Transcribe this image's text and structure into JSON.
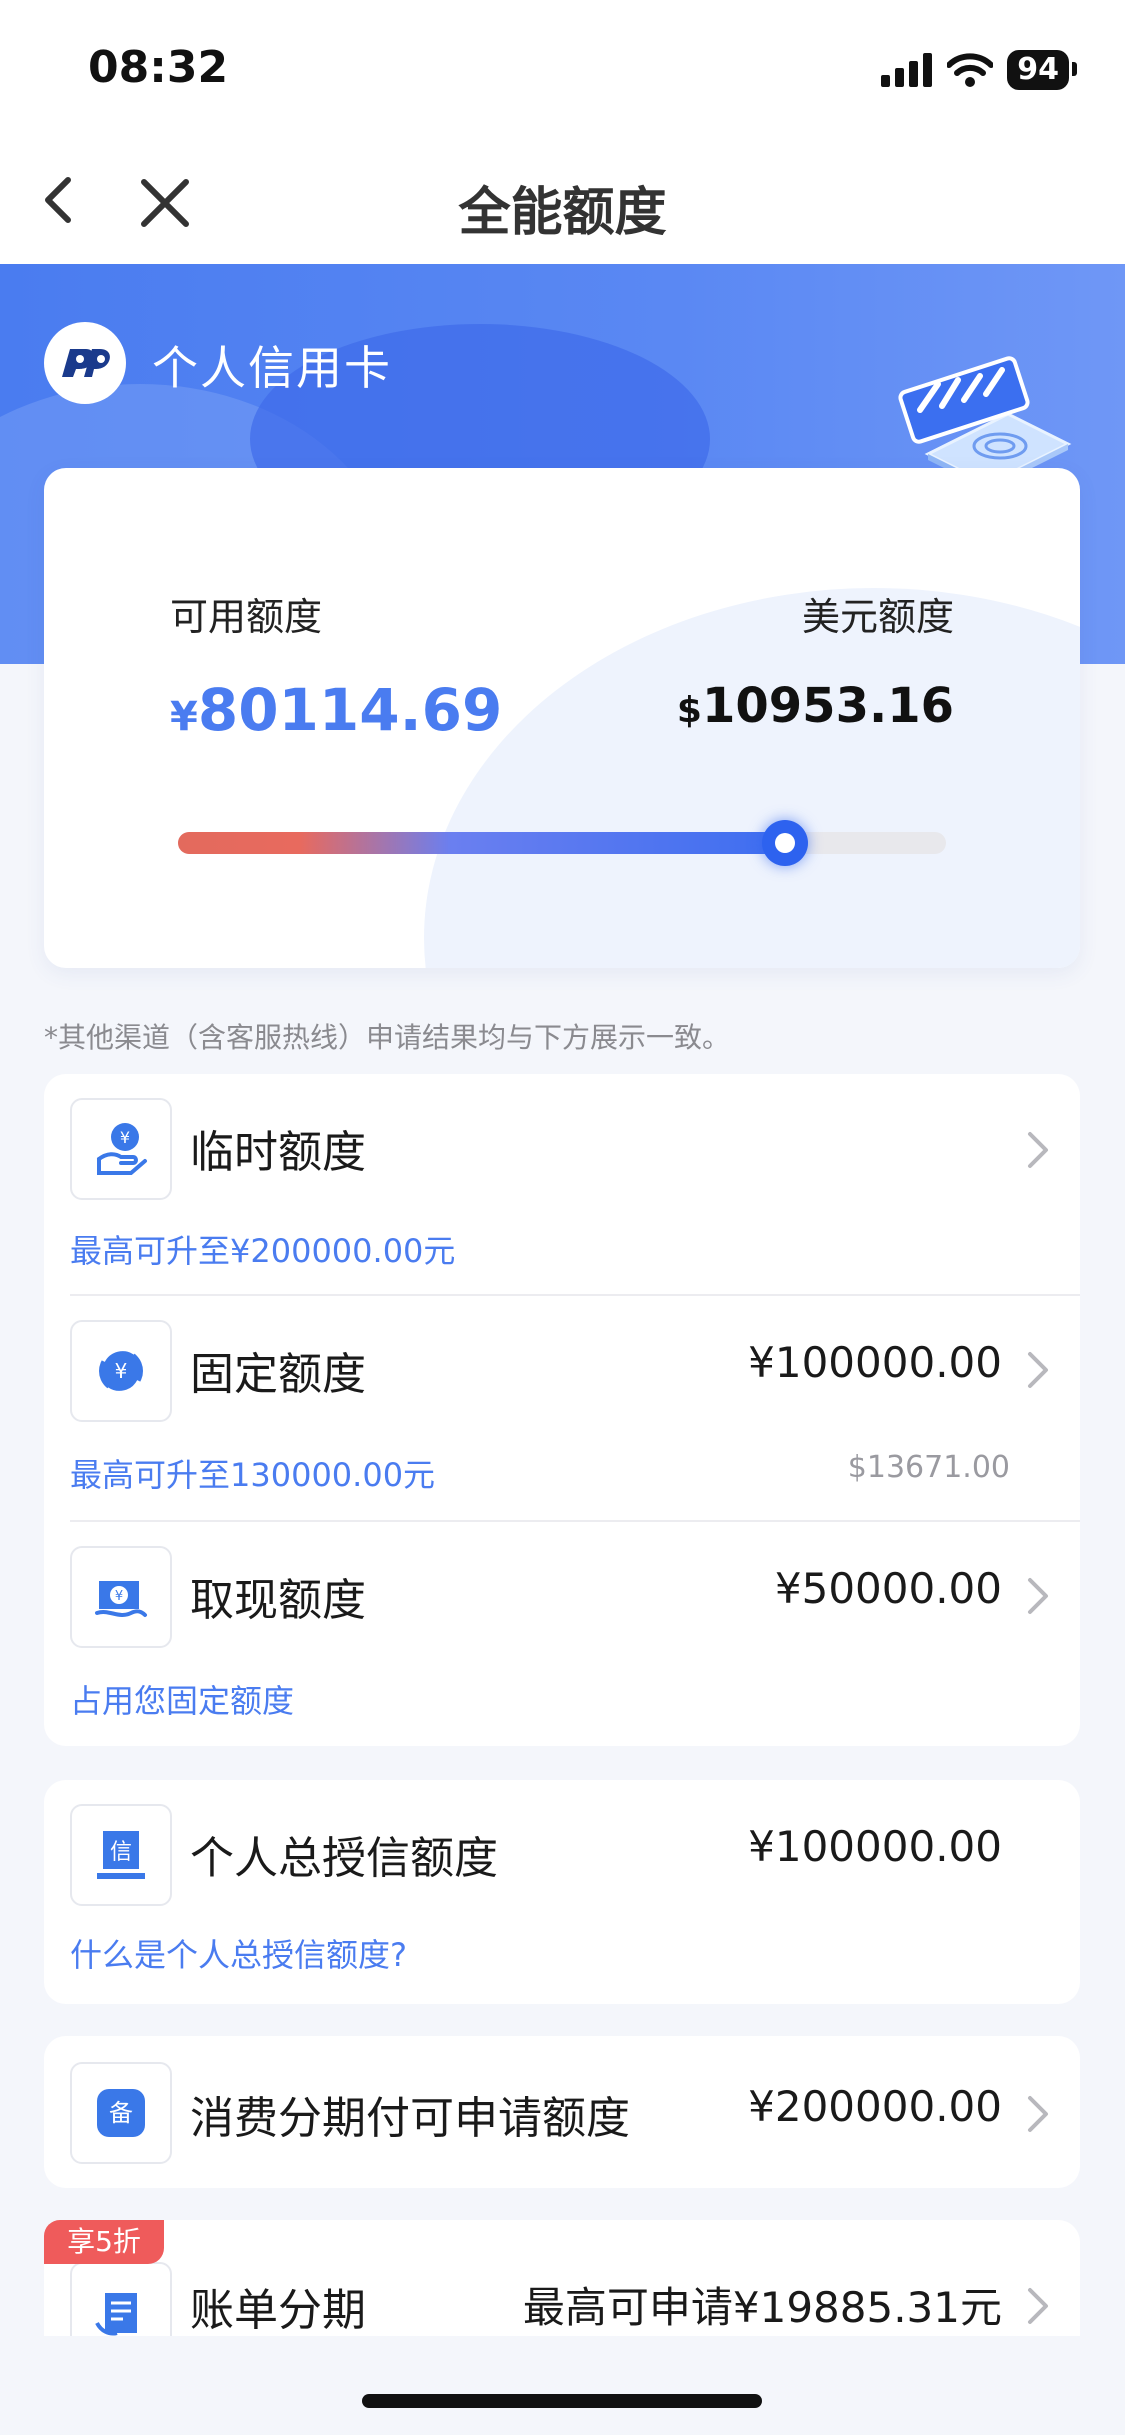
{
  "status_bar": {
    "time": "08:32",
    "battery": "94"
  },
  "nav": {
    "title": "全能额度"
  },
  "brand": {
    "name": "个人信用卡"
  },
  "limits": {
    "available_label": "可用额度",
    "available_currency": "¥",
    "available_value": "80114.69",
    "usd_label": "美元额度",
    "usd_currency": "$",
    "usd_value": "10953.16",
    "slider_fraction": 0.79
  },
  "note": "*其他渠道（含客服热线）申请结果均与下方展示一致。",
  "items": [
    {
      "title": "临时额度",
      "amount": "",
      "sub": "最高可升至¥200000.00元",
      "sub_right": "",
      "icon": "temp-limit-icon"
    },
    {
      "title": "固定额度",
      "amount": "¥100000.00",
      "sub": "最高可升至130000.00元",
      "sub_right": "$13671.00",
      "icon": "fixed-limit-icon"
    },
    {
      "title": "取现额度",
      "amount": "¥50000.00",
      "sub": "占用您固定额度",
      "sub_right": "",
      "icon": "cash-limit-icon"
    }
  ],
  "total_credit": {
    "title": "个人总授信额度",
    "amount": "¥100000.00",
    "sub": "什么是个人总授信额度?",
    "icon": "credit-doc-icon"
  },
  "installment_limit": {
    "title": "消费分期付可申请额度",
    "amount": "¥200000.00",
    "icon": "installment-icon"
  },
  "bill_installment": {
    "tag": "享5折",
    "title": "账单分期",
    "amount": "最高可申请¥19885.31元",
    "icon": "bill-icon"
  },
  "colors": {
    "accent": "#4a7cf0",
    "promo": "#ef5b5b"
  }
}
